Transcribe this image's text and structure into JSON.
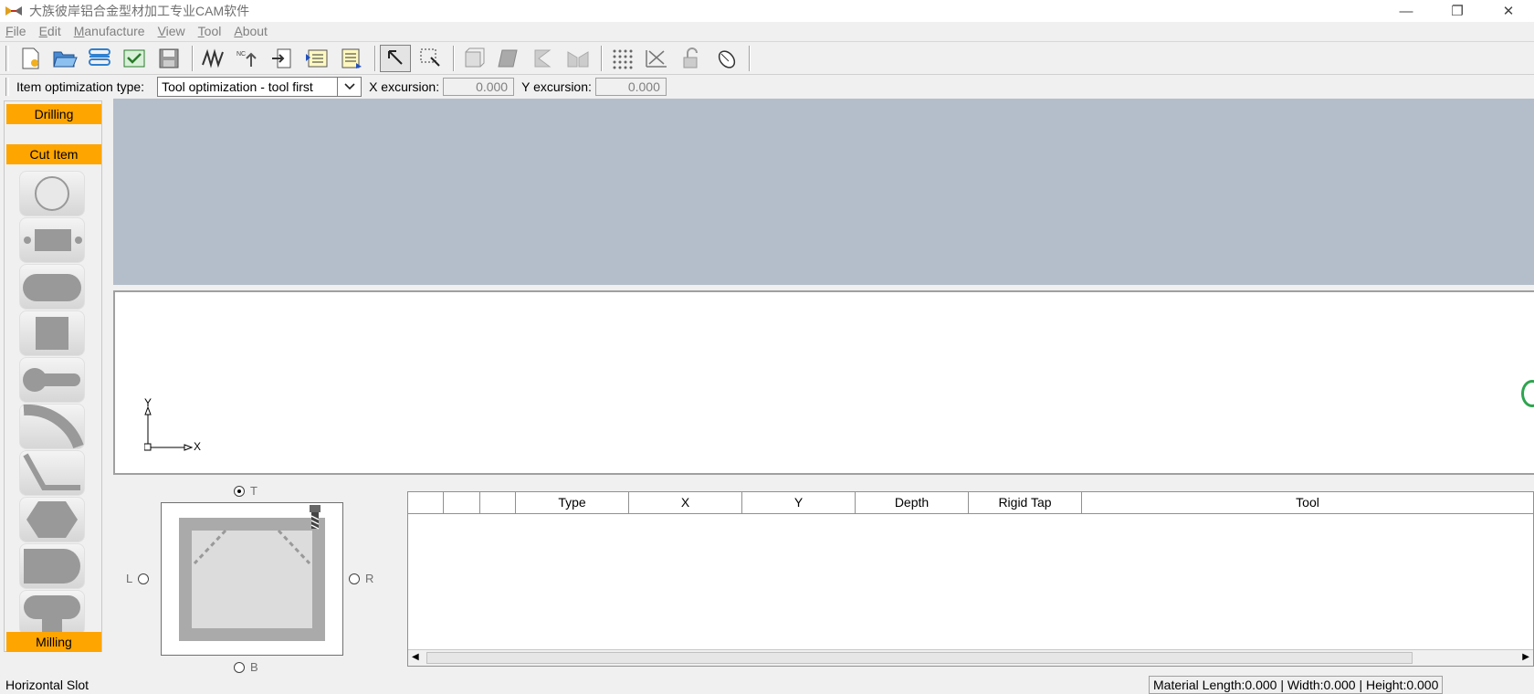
{
  "window": {
    "title": "大族彼岸铝合金型材加工专业CAM软件",
    "minimize": "—",
    "restore": "❐",
    "close": "✕"
  },
  "menu": [
    "File",
    "Edit",
    "Manufacture",
    "View",
    "Tool",
    "About"
  ],
  "options": {
    "item_optimization_label": "Item optimization type:",
    "item_optimization_value": "Tool optimization - tool first",
    "x_excursion_label": "X excursion:",
    "x_excursion_value": "0.000",
    "y_excursion_label": "Y excursion:",
    "y_excursion_value": "0.000"
  },
  "left_panel": {
    "drilling": "Drilling",
    "cut_item": "Cut Item",
    "milling": "Milling"
  },
  "axes": {
    "x": "X",
    "y": "Y"
  },
  "preview": {
    "top": "T",
    "left": "L",
    "right": "R",
    "bottom": "B",
    "selected": "T"
  },
  "grid": {
    "columns": [
      "",
      "",
      "",
      "Type",
      "X",
      "Y",
      "Depth",
      "Rigid Tap",
      "Tool"
    ]
  },
  "status": {
    "left": "Horizontal Slot",
    "right": "Material Length:0.000 | Width:0.000 | Height:0.000"
  },
  "colors": {
    "category": "#ffa500",
    "canvas_top": "#b3beca"
  }
}
